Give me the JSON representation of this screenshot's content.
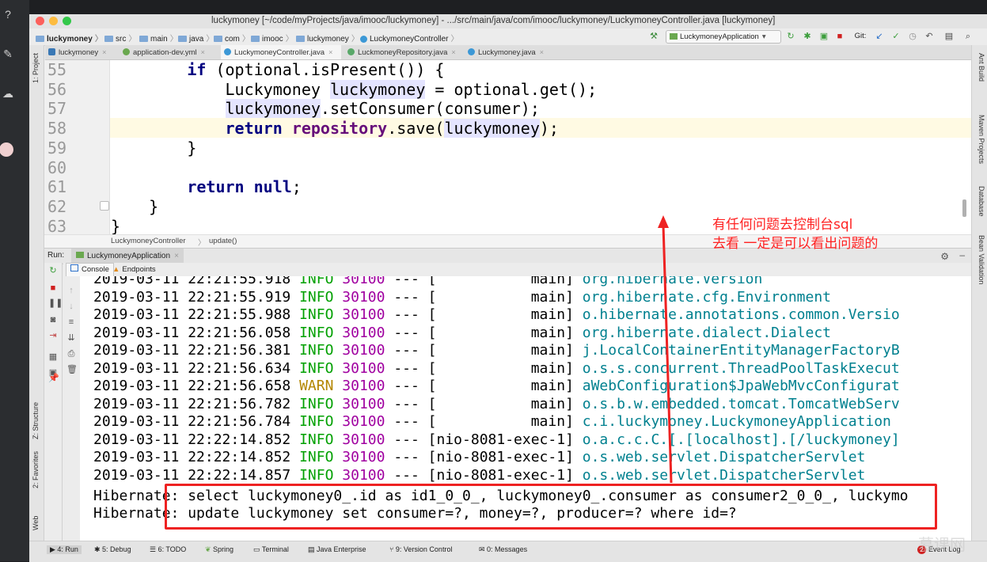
{
  "window": {
    "title": "luckymoney [~/code/myProjects/java/imooc/luckymoney] - .../src/main/java/com/imooc/luckymoney/LuckymoneyController.java [luckymoney]"
  },
  "breadcrumb": [
    "luckymoney",
    "src",
    "main",
    "java",
    "com",
    "imooc",
    "luckymoney",
    "LuckymoneyController"
  ],
  "toolbar": {
    "run_config": "LuckymoneyApplication",
    "git_label": "Git:"
  },
  "tabs": [
    {
      "label": "luckymoney",
      "active": false
    },
    {
      "label": "application-dev.yml",
      "active": false
    },
    {
      "label": "LuckymoneyController.java",
      "active": true
    },
    {
      "label": "LuckmoneyRepository.java",
      "active": false
    },
    {
      "label": "Luckymoney.java",
      "active": false
    }
  ],
  "left_tool": {
    "project": "1: Project",
    "structure": "Z: Structure",
    "favorites": "2: Favorites",
    "web": "Web"
  },
  "right_tool": {
    "ant": "Ant Build",
    "maven": "Maven Projects",
    "database": "Database",
    "bean": "Bean Validation"
  },
  "editor": {
    "line_numbers": [
      "55",
      "56",
      "57",
      "58",
      "59",
      "60",
      "61",
      "62",
      "63"
    ],
    "crumb_class": "LuckymoneyController",
    "crumb_method": "update()"
  },
  "run": {
    "label": "Run:",
    "app": "LuckymoneyApplication",
    "console_tab": "Console",
    "endpoints_tab": "Endpoints"
  },
  "log_lines": [
    {
      "ts": "2019-03-11 22:21:55.918",
      "lvl": "INFO",
      "pid": "30100",
      "sep": "---",
      "thread": "[           main]",
      "src": "org.hibernate.Version"
    },
    {
      "ts": "2019-03-11 22:21:55.919",
      "lvl": "INFO",
      "pid": "30100",
      "sep": "---",
      "thread": "[           main]",
      "src": "org.hibernate.cfg.Environment"
    },
    {
      "ts": "2019-03-11 22:21:55.988",
      "lvl": "INFO",
      "pid": "30100",
      "sep": "---",
      "thread": "[           main]",
      "src": "o.hibernate.annotations.common.Versio"
    },
    {
      "ts": "2019-03-11 22:21:56.058",
      "lvl": "INFO",
      "pid": "30100",
      "sep": "---",
      "thread": "[           main]",
      "src": "org.hibernate.dialect.Dialect"
    },
    {
      "ts": "2019-03-11 22:21:56.381",
      "lvl": "INFO",
      "pid": "30100",
      "sep": "---",
      "thread": "[           main]",
      "src": "j.LocalContainerEntityManagerFactoryB"
    },
    {
      "ts": "2019-03-11 22:21:56.634",
      "lvl": "INFO",
      "pid": "30100",
      "sep": "---",
      "thread": "[           main]",
      "src": "o.s.s.concurrent.ThreadPoolTaskExecut"
    },
    {
      "ts": "2019-03-11 22:21:56.658",
      "lvl": "WARN",
      "pid": "30100",
      "sep": "---",
      "thread": "[           main]",
      "src": "aWebConfiguration$JpaWebMvcConfigurat"
    },
    {
      "ts": "2019-03-11 22:21:56.782",
      "lvl": "INFO",
      "pid": "30100",
      "sep": "---",
      "thread": "[           main]",
      "src": "o.s.b.w.embedded.tomcat.TomcatWebServ"
    },
    {
      "ts": "2019-03-11 22:21:56.784",
      "lvl": "INFO",
      "pid": "30100",
      "sep": "---",
      "thread": "[           main]",
      "src": "c.i.luckymoney.LuckymoneyApplication"
    },
    {
      "ts": "2019-03-11 22:22:14.852",
      "lvl": "INFO",
      "pid": "30100",
      "sep": "---",
      "thread": "[nio-8081-exec-1]",
      "src": "o.a.c.c.C.[.[localhost].[/luckymoney]"
    },
    {
      "ts": "2019-03-11 22:22:14.852",
      "lvl": "INFO",
      "pid": "30100",
      "sep": "---",
      "thread": "[nio-8081-exec-1]",
      "src": "o.s.web.servlet.DispatcherServlet"
    },
    {
      "ts": "2019-03-11 22:22:14.857",
      "lvl": "INFO",
      "pid": "30100",
      "sep": "---",
      "thread": "[nio-8081-exec-1]",
      "src": "o.s.web.servlet.DispatcherServlet"
    }
  ],
  "hibernate_lines": [
    "Hibernate: select luckymoney0_.id as id1_0_0_, luckymoney0_.consumer as consumer2_0_0_, luckymo",
    "Hibernate: update luckymoney set consumer=?, money=?, producer=? where id=?"
  ],
  "annotation": {
    "line1": "有任何问题去控制台sql",
    "line2": "去看  一定是可以看出问题的"
  },
  "statusbar": {
    "run": "4: Run",
    "debug": "5: Debug",
    "todo": "6: TODO",
    "spring": "Spring",
    "terminal": "Terminal",
    "java_ee": "Java Enterprise",
    "vcs": "9: Version Control",
    "messages": "0: Messages",
    "event_log": "Event Log",
    "event_count": "2"
  },
  "watermark": "慕课网",
  "colors": {
    "annotation": "#ff2222",
    "info": "#00a000",
    "warn": "#b38600",
    "keyword": "#000080"
  }
}
